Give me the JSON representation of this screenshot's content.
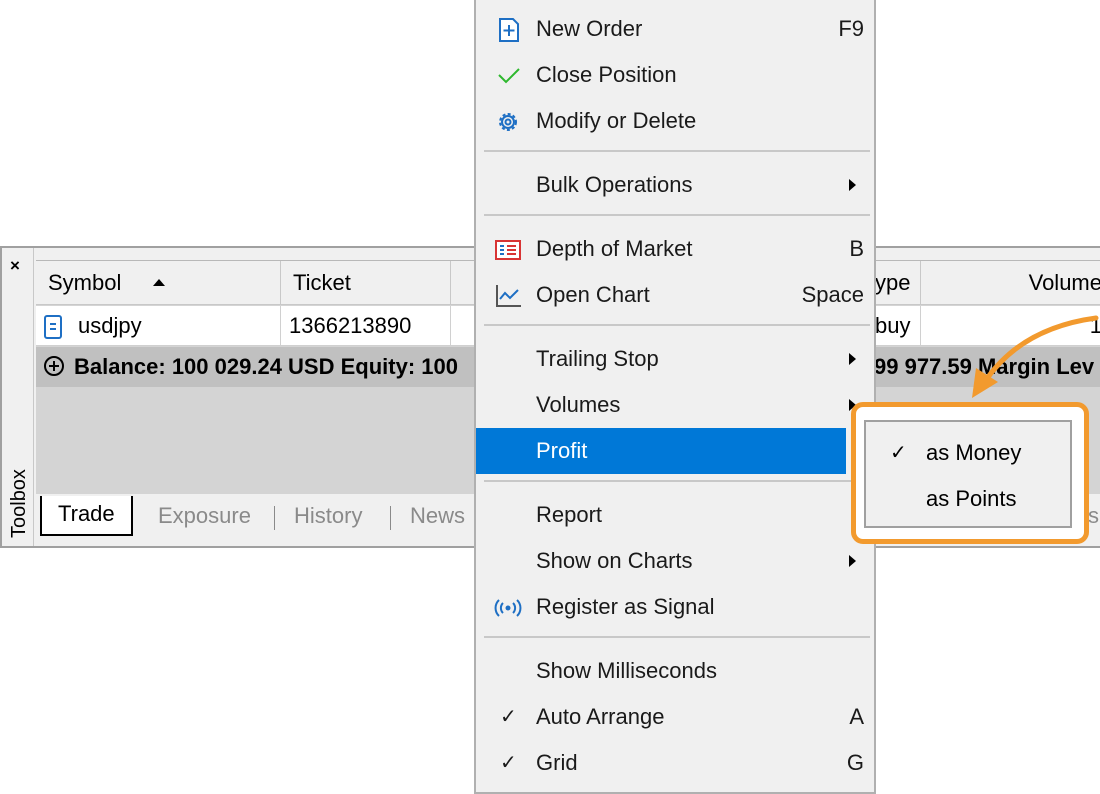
{
  "toolbox": {
    "close_glyph": "×",
    "vertical_label": "Toolbox",
    "columns": {
      "symbol": "Symbol",
      "ticket": "Ticket",
      "type_partial": "ype",
      "volume": "Volume"
    },
    "row": {
      "symbol": "usdjpy",
      "ticket": "1366213890",
      "type_partial": "buy",
      "volume_partial": "1"
    },
    "summary": {
      "left_text": "Balance: 100 029.24 USD  Equity: 100",
      "right_text": "99 977.59  Margin Lev"
    },
    "tabs": {
      "trade": "Trade",
      "exposure": "Exposure",
      "history": "History",
      "news": "News",
      "partial_right": "s"
    }
  },
  "context_menu": {
    "items": [
      {
        "label": "New Order",
        "shortcut": "F9",
        "icon": "new-order-icon"
      },
      {
        "label": "Close Position",
        "shortcut": "",
        "icon": "checkmark-icon"
      },
      {
        "label": "Modify or Delete",
        "shortcut": "",
        "icon": "gear-icon"
      },
      {
        "label": "Bulk Operations",
        "shortcut": "",
        "submenu": true
      },
      {
        "label": "Depth of Market",
        "shortcut": "B",
        "icon": "depth-of-market-icon"
      },
      {
        "label": "Open Chart",
        "shortcut": "Space",
        "icon": "chart-line-icon"
      },
      {
        "label": "Trailing Stop",
        "submenu": true
      },
      {
        "label": "Volumes",
        "submenu": true
      },
      {
        "label": "Profit",
        "submenu": true,
        "highlighted": true
      },
      {
        "label": "Report"
      },
      {
        "label": "Show on Charts",
        "submenu": true
      },
      {
        "label": "Register as Signal",
        "icon": "signal-broadcast-icon"
      },
      {
        "label": "Show Milliseconds"
      },
      {
        "label": "Auto Arrange",
        "shortcut": "A",
        "checked": true
      },
      {
        "label": "Grid",
        "shortcut": "G",
        "checked": true
      }
    ],
    "check_glyph": "✓"
  },
  "profit_submenu": {
    "items": [
      {
        "label": "as Money",
        "checked": true
      },
      {
        "label": "as Points",
        "checked": false
      }
    ]
  },
  "colors": {
    "highlight": "#0078d7",
    "callout": "#f29a2e",
    "icon_blue": "#1e6fc4",
    "icon_green": "#2eb82e",
    "icon_red": "#d83434"
  }
}
